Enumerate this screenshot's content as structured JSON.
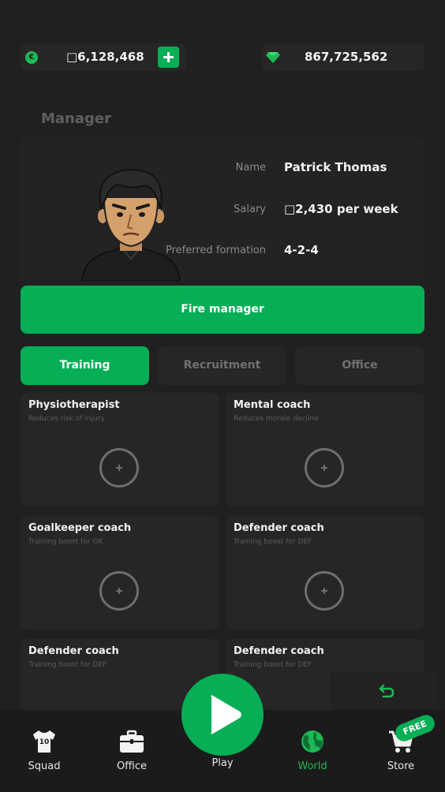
{
  "currency": {
    "coins": "□6,128,468",
    "gems": "867,725,562"
  },
  "section_title": "Manager",
  "manager": {
    "name_label": "Name",
    "name_value": "Patrick Thomas",
    "salary_label": "Salary",
    "salary_value": "□2,430 per week",
    "formation_label": "Preferred formation",
    "formation_value": "4-2-4"
  },
  "fire_button": "Fire manager",
  "tabs": [
    {
      "label": "Training",
      "active": true
    },
    {
      "label": "Recruitment",
      "active": false
    },
    {
      "label": "Office",
      "active": false
    }
  ],
  "staff": [
    {
      "title": "Physiotherapist",
      "desc": "Reduces risk of injury"
    },
    {
      "title": "Mental coach",
      "desc": "Reduces morale decline"
    },
    {
      "title": "Goalkeeper coach",
      "desc": "Training boost for GK"
    },
    {
      "title": "Defender coach",
      "desc": "Training boost for DEF"
    },
    {
      "title": "Defender coach",
      "desc": "Training boost for DEF"
    },
    {
      "title": "Defender coach",
      "desc": "Training boost for DEF"
    }
  ],
  "nav": {
    "squad": "Squad",
    "office": "Office",
    "play": "Play",
    "world": "World",
    "store": "Store",
    "free_badge": "FREE",
    "jersey_number": "10"
  },
  "colors": {
    "accent": "#06ae55",
    "background": "#202020",
    "card": "#262626"
  }
}
